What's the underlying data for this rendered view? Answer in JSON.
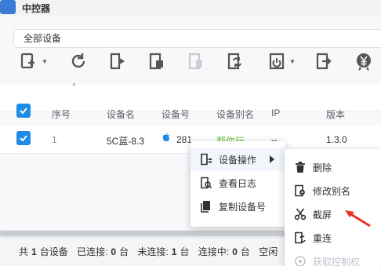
{
  "app": {
    "title": "中控器"
  },
  "device_select": {
    "value": "全部设备"
  },
  "toolbar": {
    "buttons": [
      {
        "name": "add-device-icon",
        "has_caret": true
      },
      {
        "name": "refresh-icon"
      },
      {
        "name": "play-script-icon"
      },
      {
        "name": "stop-script-icon"
      },
      {
        "name": "pause-script-icon"
      },
      {
        "name": "sync-icon"
      },
      {
        "name": "power-icon",
        "has_caret": true
      },
      {
        "name": "export-icon"
      },
      {
        "name": "yen-icon"
      }
    ]
  },
  "table": {
    "headers": {
      "index": "序号",
      "device_name": "设备名",
      "device_no": "设备号",
      "alias": "设备别名",
      "ip": "IP",
      "version": "版本"
    },
    "rows": [
      {
        "index": "1",
        "device_name": "5C蓝-8.3",
        "device_no": "281",
        "alias": "帮你玩",
        "ip": "--",
        "version": "1.3.0"
      }
    ]
  },
  "status": {
    "total_prefix": "共",
    "total": "1",
    "total_suffix": "台设备",
    "connected_label": "已连接:",
    "connected": "0",
    "connected_unit": "台",
    "disconnected_label": "未连接:",
    "disconnected": "1",
    "disconnected_unit": "台",
    "connecting_label": "连接中:",
    "connecting": "0",
    "connecting_unit": "台",
    "idle_label": "空闲"
  },
  "context_menu": {
    "items": [
      {
        "label": "设备操作",
        "icon": "device-ops-icon",
        "submenu": true
      },
      {
        "label": "查看日志",
        "icon": "log-icon"
      },
      {
        "label": "复制设备号",
        "icon": "copy-icon"
      }
    ]
  },
  "submenu": {
    "items": [
      {
        "label": "删除",
        "icon": "trash-icon"
      },
      {
        "label": "修改别名",
        "icon": "edit-gear-icon"
      },
      {
        "label": "截屏",
        "icon": "scissors-icon"
      },
      {
        "label": "重连",
        "icon": "reconnect-icon"
      },
      {
        "label": "获取控制权",
        "icon": "control-icon",
        "disabled": true
      }
    ]
  },
  "colors": {
    "accent": "#1e8be6",
    "alias_green": "#67c23a",
    "annotation_red": "#e8312a"
  }
}
